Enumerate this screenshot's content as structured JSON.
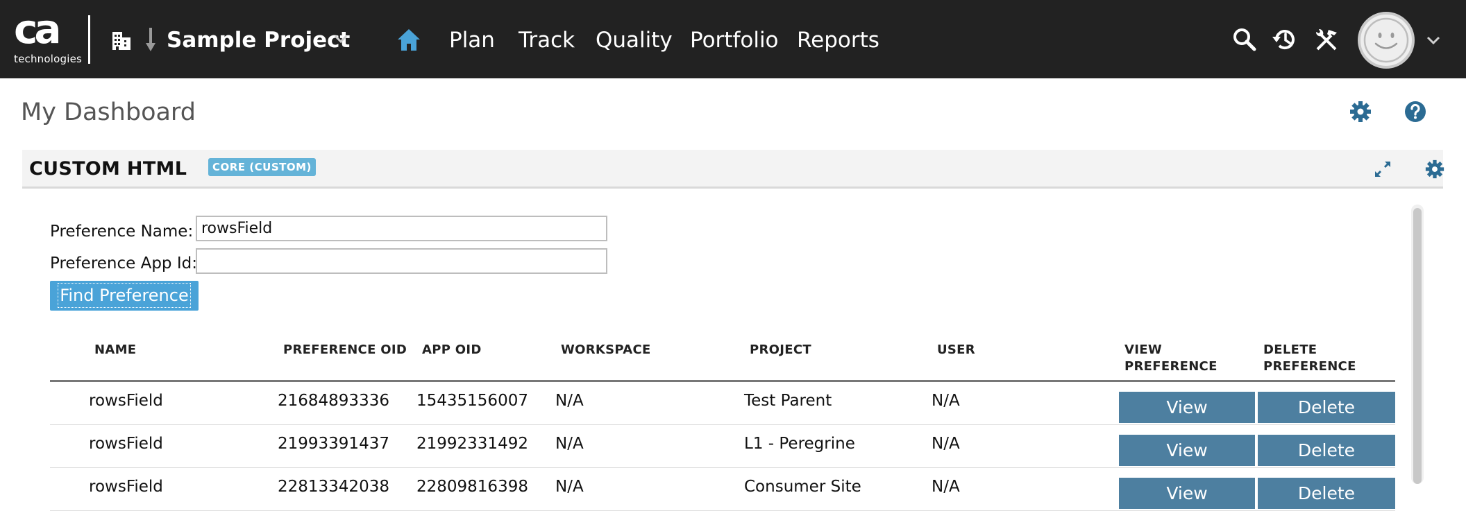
{
  "topbar": {
    "logo_main": "ca",
    "logo_sub": "technologies",
    "project_name": "Sample Project",
    "nav": [
      "Plan",
      "Track",
      "Quality",
      "Portfolio",
      "Reports"
    ]
  },
  "page": {
    "title": "My Dashboard"
  },
  "panel": {
    "title": "CUSTOM HTML",
    "badge": "CORE (CUSTOM)"
  },
  "form": {
    "pref_name_label": "Preference Name:",
    "pref_name_value": "rowsField",
    "pref_app_label": "Preference App Id:",
    "pref_app_value": "",
    "find_button": "Find Preference"
  },
  "table": {
    "headers": [
      "NAME",
      "PREFERENCE OID",
      "APP OID",
      "WORKSPACE",
      "PROJECT",
      "USER",
      "VIEW\nPREFERENCE",
      "DELETE\nPREFERENCE"
    ],
    "rows": [
      {
        "name": "rowsField",
        "pref_oid": "21684893336",
        "app_oid": "15435156007",
        "workspace": "N/A",
        "project": "Test Parent",
        "user": "N/A"
      },
      {
        "name": "rowsField",
        "pref_oid": "21993391437",
        "app_oid": "21992331492",
        "workspace": "N/A",
        "project": "L1 - Peregrine",
        "user": "N/A"
      },
      {
        "name": "rowsField",
        "pref_oid": "22813342038",
        "app_oid": "22809816398",
        "workspace": "N/A",
        "project": "Consumer Site",
        "user": "N/A"
      }
    ],
    "view_label": "View",
    "delete_label": "Delete"
  },
  "colors": {
    "topbar_bg": "#222222",
    "accent_blue": "#4aa3d8",
    "button_blue": "#4d7fa0",
    "icon_blue": "#2b6b93",
    "badge_bg": "#64b3d8"
  }
}
